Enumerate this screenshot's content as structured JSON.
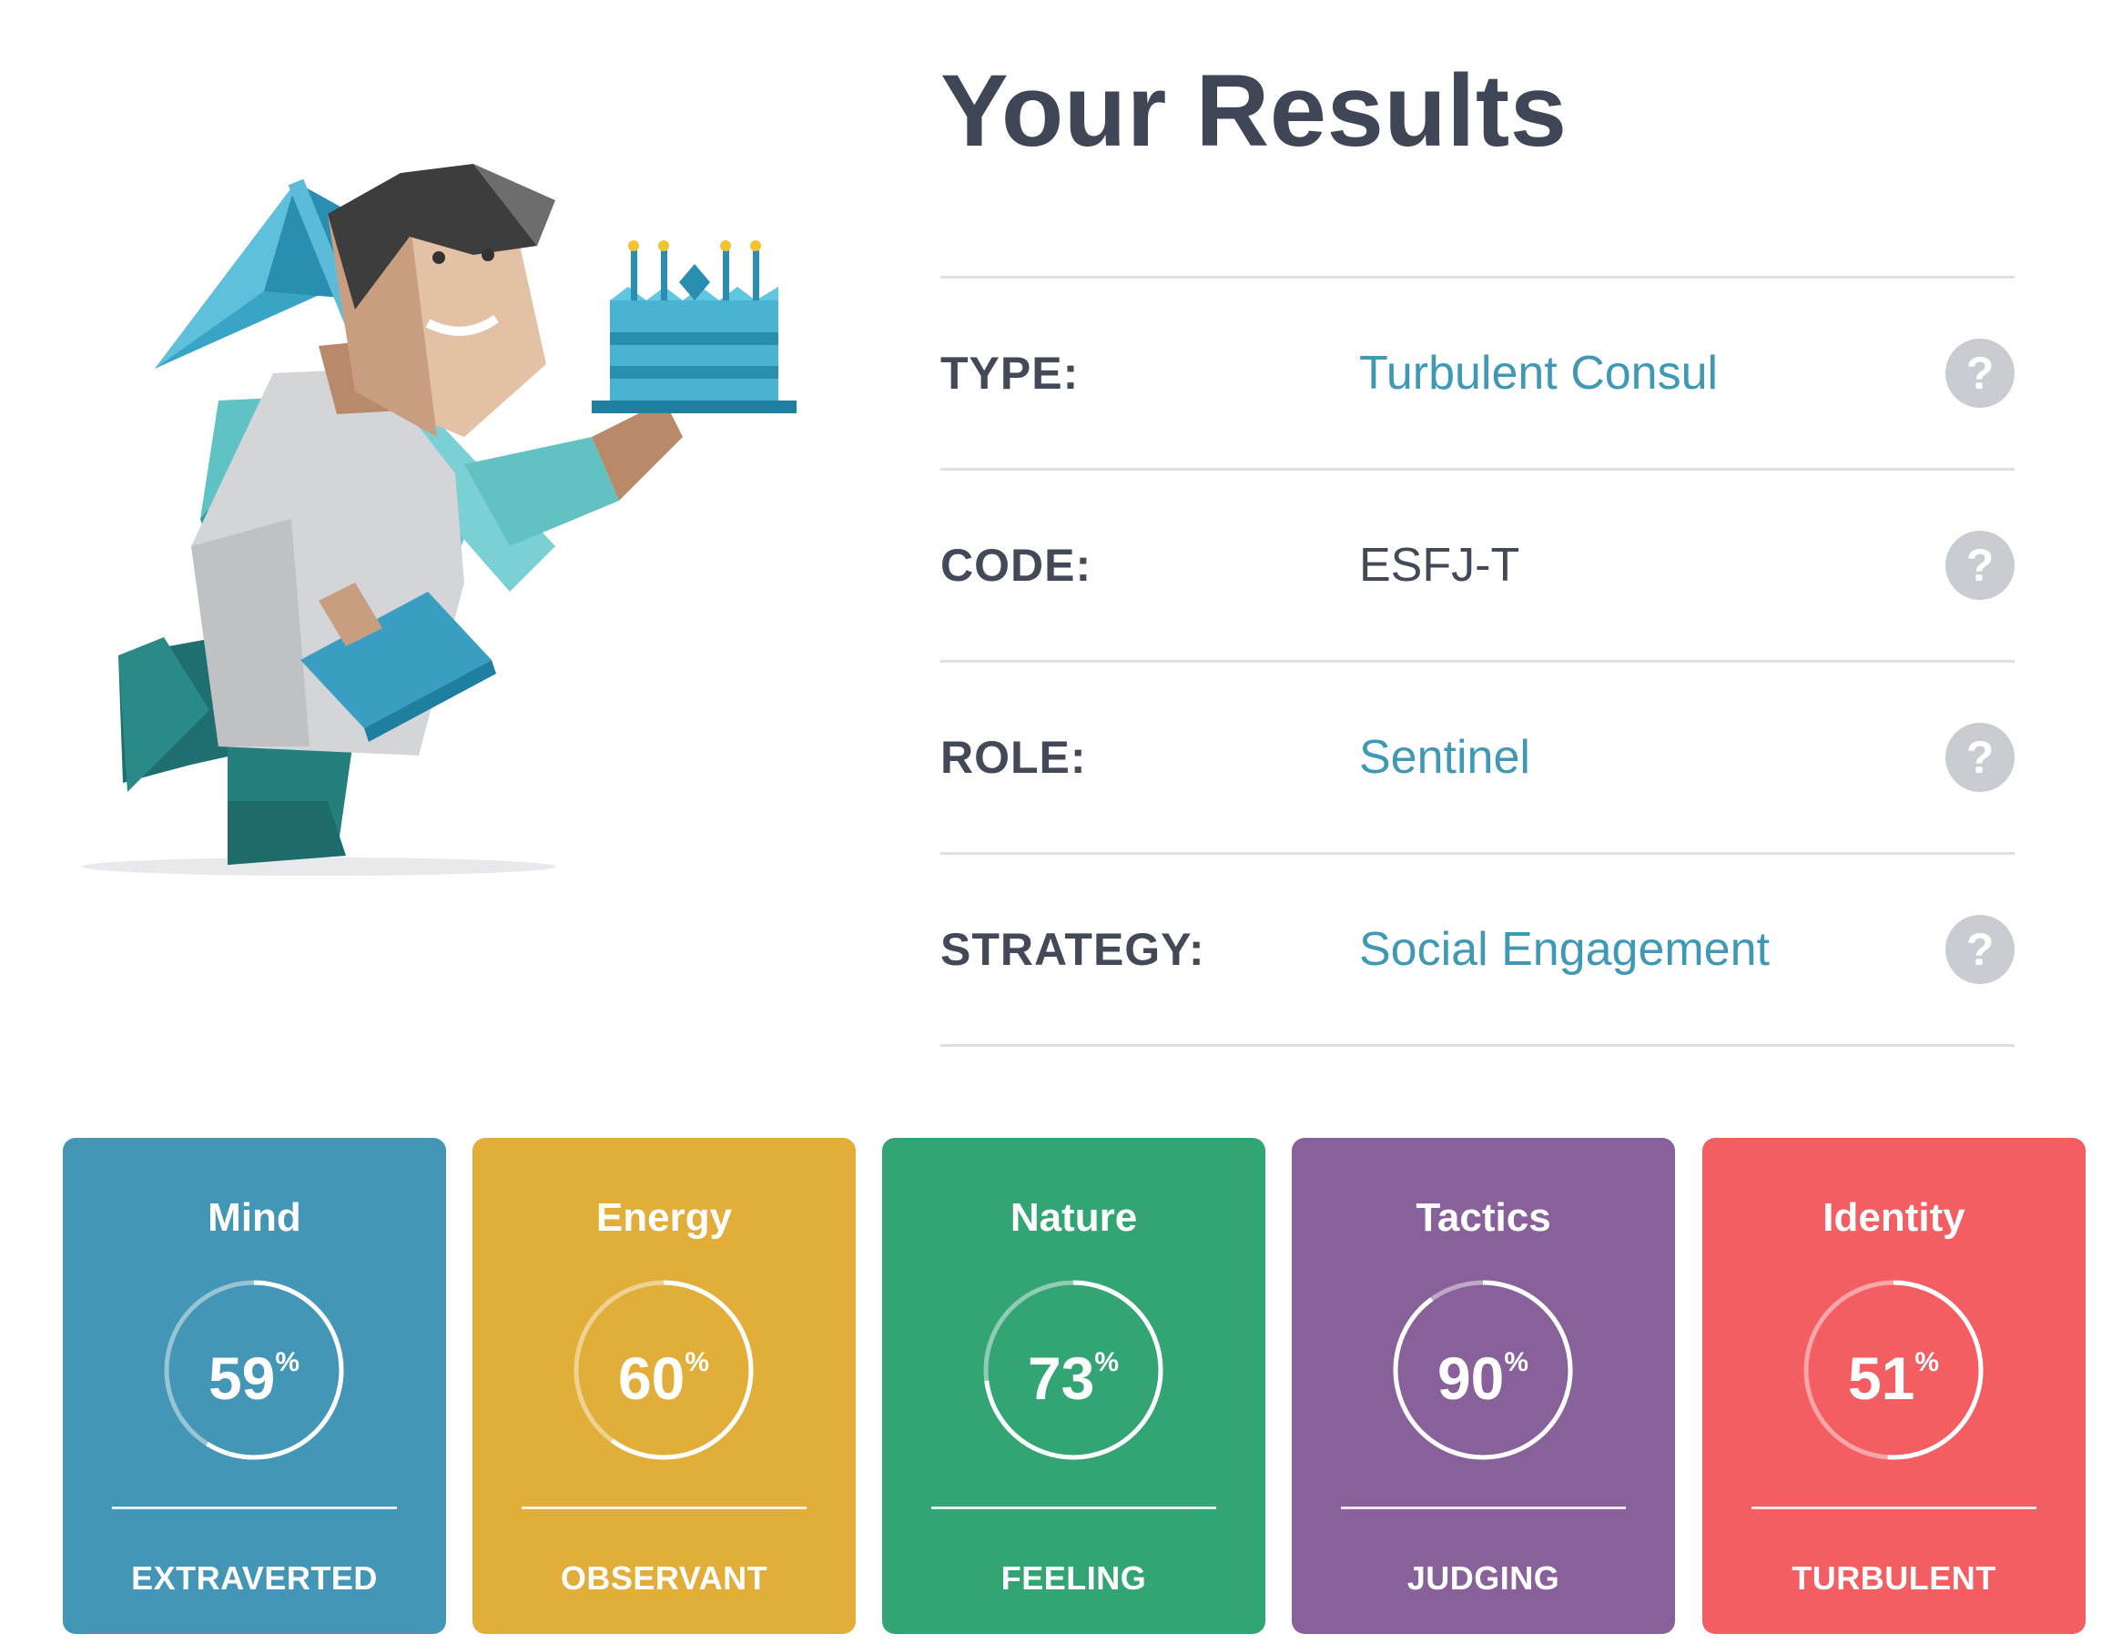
{
  "header": {
    "title": "Your Results"
  },
  "illustration": {
    "subject": "consul-character-with-cake-and-umbrella-icon"
  },
  "results": [
    {
      "label": "TYPE:",
      "value": "Turbulent Consul",
      "link": true
    },
    {
      "label": "CODE:",
      "value": "ESFJ-T",
      "link": false
    },
    {
      "label": "ROLE:",
      "value": "Sentinel",
      "link": true
    },
    {
      "label": "STRATEGY:",
      "value": "Social Engagement",
      "link": true
    }
  ],
  "help_icon": "?",
  "cards": [
    {
      "title": "Mind",
      "percent": 59,
      "percent_symbol": "%",
      "trait": "EXTRAVERTED",
      "color": "#4396b5"
    },
    {
      "title": "Energy",
      "percent": 60,
      "percent_symbol": "%",
      "trait": "OBSERVANT",
      "color": "#e2ae3a"
    },
    {
      "title": "Nature",
      "percent": 73,
      "percent_symbol": "%",
      "trait": "FEELING",
      "color": "#33a474"
    },
    {
      "title": "Tactics",
      "percent": 90,
      "percent_symbol": "%",
      "trait": "JUDGING",
      "color": "#88619a"
    },
    {
      "title": "Identity",
      "percent": 51,
      "percent_symbol": "%",
      "trait": "TURBULENT",
      "color": "#f25e62"
    }
  ],
  "colors": {
    "title_text": "#3f4656",
    "link_text": "#3f99b4",
    "divider": "#dcdfe3",
    "help_button": "#c9ccd1"
  }
}
